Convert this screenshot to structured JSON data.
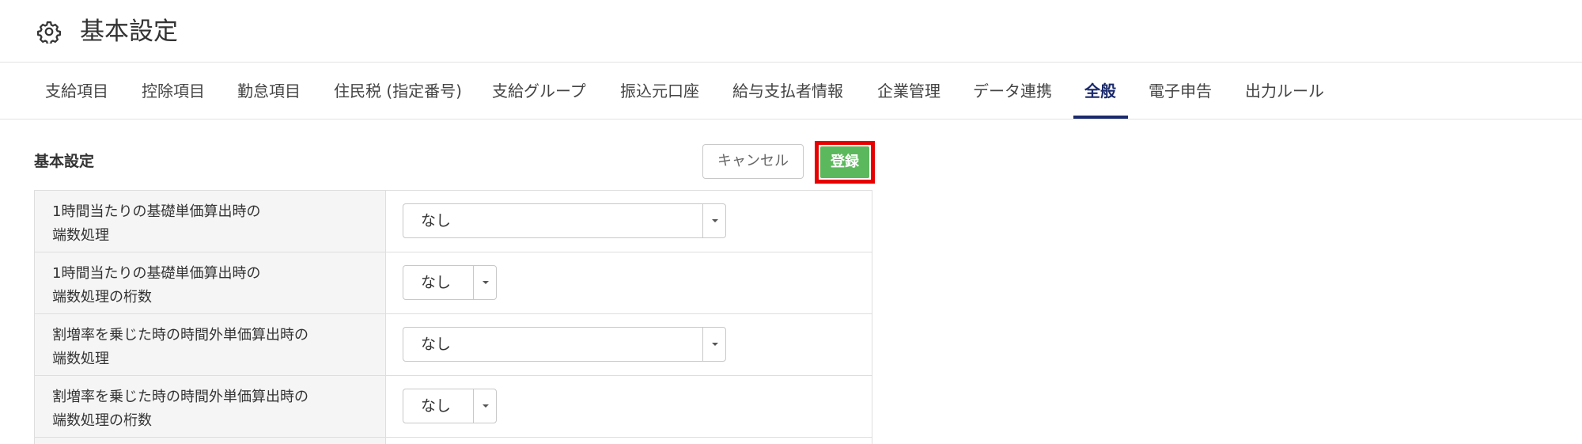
{
  "header": {
    "icon": "gear-icon",
    "title": "基本設定"
  },
  "tabs": [
    {
      "label": "支給項目",
      "active": false
    },
    {
      "label": "控除項目",
      "active": false
    },
    {
      "label": "勤怠項目",
      "active": false
    },
    {
      "label": "住民税 (指定番号)",
      "active": false
    },
    {
      "label": "支給グループ",
      "active": false
    },
    {
      "label": "振込元口座",
      "active": false
    },
    {
      "label": "給与支払者情報",
      "active": false
    },
    {
      "label": "企業管理",
      "active": false
    },
    {
      "label": "データ連携",
      "active": false
    },
    {
      "label": "全般",
      "active": true
    },
    {
      "label": "電子申告",
      "active": false
    },
    {
      "label": "出力ルール",
      "active": false
    }
  ],
  "section": {
    "title": "基本設定",
    "cancel_label": "キャンセル",
    "save_label": "登録"
  },
  "settings": [
    {
      "label_line1": "1時間当たりの基礎単価算出時の",
      "label_line2": "端数処理",
      "value": "なし"
    },
    {
      "label_line1": "1時間当たりの基礎単価算出時の",
      "label_line2": "端数処理の桁数",
      "value": "なし"
    },
    {
      "label_line1": "割増率を乗じた時の時間外単価算出時の",
      "label_line2": "端数処理",
      "value": "なし"
    },
    {
      "label_line1": "割増率を乗じた時の時間外単価算出時の",
      "label_line2": "端数処理の桁数",
      "value": "なし"
    }
  ],
  "colors": {
    "accent": "#1a2a6c",
    "save_button": "#5cb85c",
    "highlight_frame": "#e60000"
  }
}
